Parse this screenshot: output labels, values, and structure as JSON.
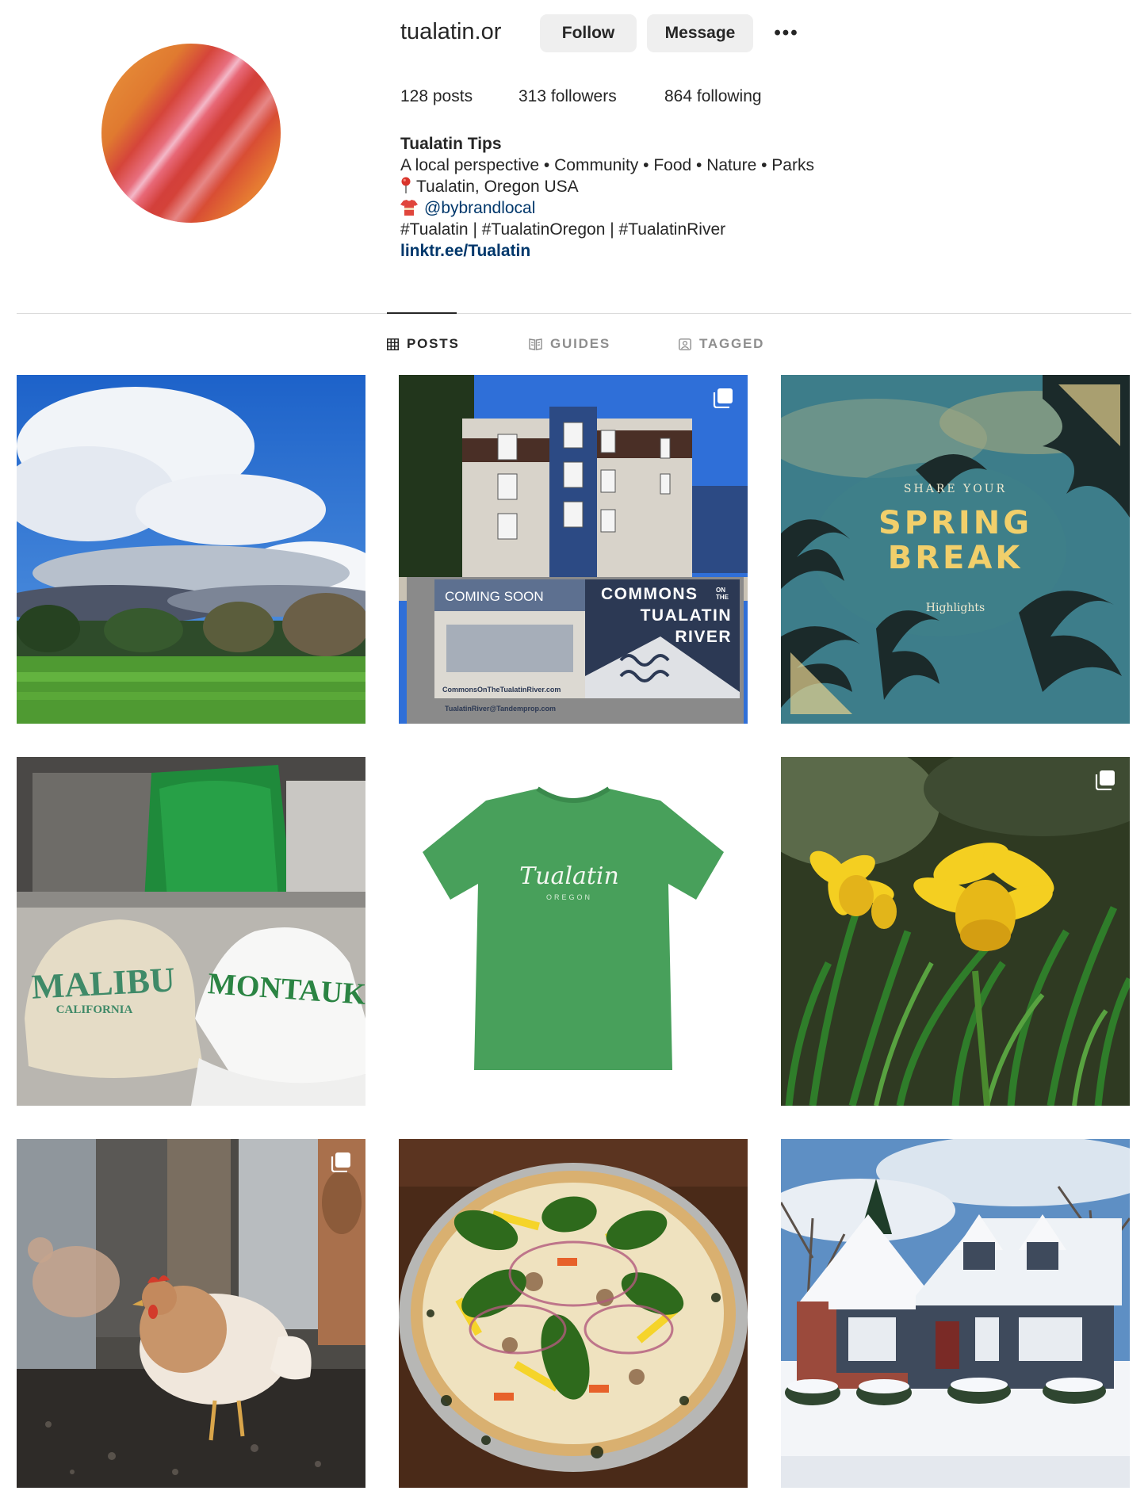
{
  "profile": {
    "username": "tualatin.or",
    "follow_label": "Follow",
    "message_label": "Message",
    "more_label": "•••"
  },
  "stats": {
    "posts": "128 posts",
    "followers": "313 followers",
    "following": "864 following"
  },
  "bio": {
    "name": "Tualatin Tips",
    "tagline": "A local perspective • Community • Food • Nature • Parks",
    "location": "Tualatin, Oregon USA",
    "mention": "@bybrandlocal",
    "hashtags": "#Tualatin | #TualatinOregon | #TualatinRiver",
    "link": "linktr.ee/Tualatin"
  },
  "tabs": {
    "posts": "POSTS",
    "guides": "GUIDES",
    "tagged": "TAGGED"
  },
  "posts": {
    "p2": {
      "banner_left": "COMING SOON",
      "banner_title": "COMMONS",
      "banner_on": "ON",
      "banner_the": "THE",
      "banner_line2": "TUALATIN",
      "banner_line3": "RIVER",
      "banner_url1": "CommonsOnTheTualatinRiver.com",
      "banner_url2": "TualatinRiver@Tandemprop.com"
    },
    "p3": {
      "top": "SHARE YOUR",
      "line1": "SPRING",
      "line2": "BREAK",
      "sub": "Highlights"
    },
    "p4": {
      "cap1_text": "MALIBU",
      "cap1_sub": "CALIFORNIA",
      "cap2_text": "MONTAUK"
    },
    "p5": {
      "shirt_text": "Tualatin",
      "shirt_sub": "OREGON"
    }
  },
  "colors": {
    "link": "#00376b",
    "button_bg": "#efefef",
    "text": "#262626",
    "muted": "#8e8e8e"
  }
}
